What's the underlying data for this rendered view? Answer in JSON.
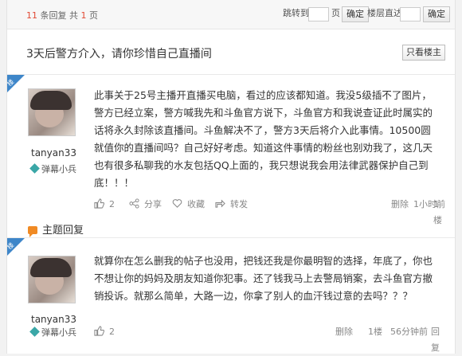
{
  "pager": {
    "count": "11",
    "count_label": "条回复 共",
    "pages": "1",
    "page_unit": "页",
    "jump_label": "跳转到",
    "jump_unit": "页",
    "confirm": "确定",
    "floor_label": "楼层直达",
    "confirm2": "确定"
  },
  "thread": {
    "title": "3天后警方介入，请你珍惜自己直播间",
    "only_host": "只看楼主"
  },
  "posts": [
    {
      "badge": "楼主",
      "user": "tanyan33",
      "rank": "弹幕小兵",
      "content": "此事关于25号主播开直播买电脑，看过的应该都知道。我没5级插不了图片，警方已经立案，警方喊我先和斗鱼官方说下，斗鱼官方和我说查证此时属实的话将永久封除该直播间。斗鱼解决不了，警方3天后将介入此事情。10500圆就值你的直播间吗？自己好好考虑。知道这件事情的粉丝也别劝我了，这几天也有很多私聊我的水友包括QQ上面的，我只想说我会用法律武器保护自己到底！！！",
      "likes": "2",
      "share": "分享",
      "collect": "收藏",
      "forward": "转发",
      "delete": "删除",
      "floor": "1楼",
      "time": "1小时前"
    },
    {
      "badge": "楼主",
      "user": "tanyan33",
      "rank": "弹幕小兵",
      "content": "就算你在怎么删我的帖子也没用，把钱还我是你最明智的选择，年底了，你也不想让你的妈妈及朋友知道你犯事。还了钱我马上去警局销案，去斗鱼官方撤销投诉。就那么简单，大路一边，你拿了别人的血汗钱过意的去吗？？？",
      "likes": "2",
      "delete": "删除",
      "floor": "1楼",
      "time": "56分钟前",
      "reply": "回复"
    }
  ],
  "topic_reply": "主题回复"
}
